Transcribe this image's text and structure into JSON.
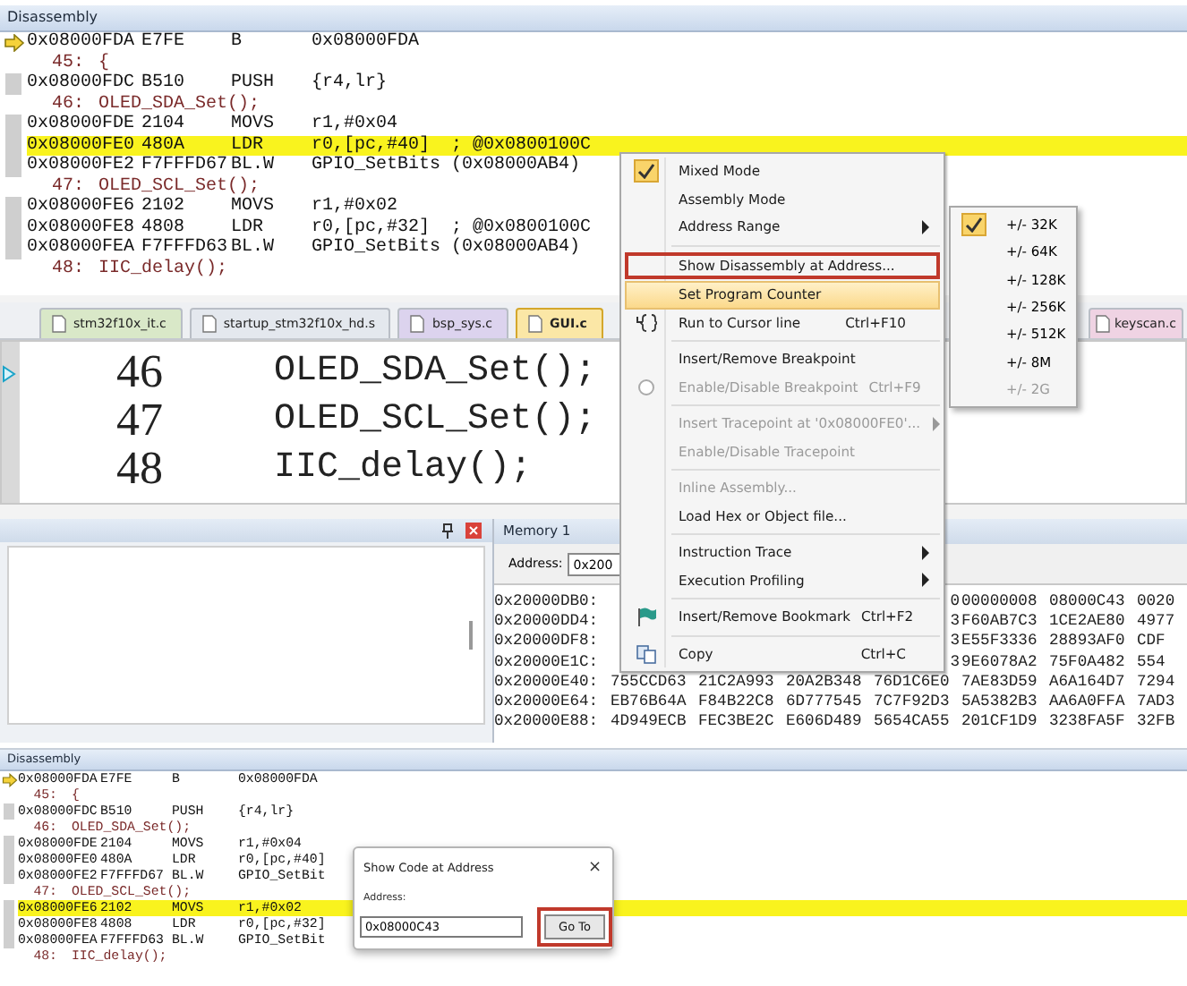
{
  "top_disassembly": {
    "title": "Disassembly",
    "rows": [
      {
        "kind": "asm",
        "address": "0x08000FDA",
        "code": "E7FE",
        "mnemonic": "B",
        "operands": "0x08000FDA",
        "current": true,
        "highlighted": false
      },
      {
        "kind": "src",
        "line": "45:",
        "text": "{"
      },
      {
        "kind": "asm",
        "address": "0x08000FDC",
        "code": "B510",
        "mnemonic": "PUSH",
        "operands": "{r4,lr}",
        "current": false,
        "highlighted": false
      },
      {
        "kind": "src",
        "line": "46:",
        "text": "OLED_SDA_Set();"
      },
      {
        "kind": "asm",
        "address": "0x08000FDE",
        "code": "2104",
        "mnemonic": "MOVS",
        "operands": "r1,#0x04",
        "current": false,
        "highlighted": false
      },
      {
        "kind": "asm",
        "address": "0x08000FE0",
        "code": "480A",
        "mnemonic": "LDR",
        "operands": "r0,[pc,#40]  ; @0x0800100C",
        "current": false,
        "highlighted": true
      },
      {
        "kind": "asm",
        "address": "0x08000FE2",
        "code": "F7FFFD67",
        "mnemonic": "BL.W",
        "operands": "GPIO_SetBits (0x08000AB4)",
        "current": false,
        "highlighted": false
      },
      {
        "kind": "src",
        "line": "47:",
        "text": "OLED_SCL_Set();"
      },
      {
        "kind": "asm",
        "address": "0x08000FE6",
        "code": "2102",
        "mnemonic": "MOVS",
        "operands": "r1,#0x02",
        "current": false,
        "highlighted": false
      },
      {
        "kind": "asm",
        "address": "0x08000FE8",
        "code": "4808",
        "mnemonic": "LDR",
        "operands": "r0,[pc,#32]  ; @0x0800100C",
        "current": false,
        "highlighted": false
      },
      {
        "kind": "asm",
        "address": "0x08000FEA",
        "code": "F7FFFD63",
        "mnemonic": "BL.W",
        "operands": "GPIO_SetBits (0x08000AB4)",
        "current": false,
        "highlighted": false
      },
      {
        "kind": "src",
        "line": "48:",
        "text": "IIC_delay();"
      }
    ]
  },
  "editor": {
    "tabs": [
      {
        "label": "stm32f10x_it.c",
        "color": "#d9e8c8",
        "selected": false
      },
      {
        "label": "startup_stm32f10x_hd.s",
        "color": "#e4e8ee",
        "selected": false
      },
      {
        "label": "bsp_sys.c",
        "color": "#dcd3ee",
        "selected": false
      },
      {
        "label": "GUI.c",
        "color": "#fbe7a6",
        "selected": true
      },
      {
        "label": "keyscan.c",
        "color": "#efd3e3",
        "selected": false
      }
    ],
    "lines": [
      {
        "number": "46",
        "code": "OLED_SDA_Set();",
        "current": true
      },
      {
        "number": "47",
        "code": "OLED_SCL_Set();",
        "current": false
      },
      {
        "number": "48",
        "code": "IIC_delay();",
        "current": false
      }
    ]
  },
  "memory": {
    "title": "Memory 1",
    "address_label": "Address:",
    "address_value": "0x200",
    "rows": [
      {
        "address": "0x20000DB0:",
        "values": [
          "0",
          "00000008",
          "08000C43",
          "0020"
        ]
      },
      {
        "address": "0x20000DD4:",
        "values": [
          "3",
          "F60AB7C3",
          "1CE2AE80",
          "4977"
        ]
      },
      {
        "address": "0x20000DF8:",
        "values": [
          "3",
          "E55F3336",
          "28893AF0",
          "CDF"
        ]
      },
      {
        "address": "0x20000E1C:",
        "values": [
          "3",
          "9E6078A2",
          "75F0A482",
          "554"
        ]
      },
      {
        "address": "0x20000E40:",
        "values": [
          "755CCD63",
          "21C2A993",
          "20A2B348",
          "76D1C6E0",
          "7AE83D59",
          "A6A164D7",
          "7294"
        ]
      },
      {
        "address": "0x20000E64:",
        "values": [
          "EB76B64A",
          "F84B22C8",
          "6D777545",
          "7C7F92D3",
          "5A5382B3",
          "AA6A0FFA",
          "7AD3"
        ]
      },
      {
        "address": "0x20000E88:",
        "values": [
          "4D949ECB",
          "FEC3BE2C",
          "E606D489",
          "5654CA55",
          "201CF1D9",
          "3238FA5F",
          "32FB"
        ]
      }
    ]
  },
  "context_menu": {
    "items": [
      {
        "kind": "item",
        "label": "Mixed Mode",
        "checked": true,
        "disabled": false,
        "selected": false,
        "submenu": false,
        "outlined": false
      },
      {
        "kind": "item",
        "label": "Assembly Mode",
        "checked": false,
        "disabled": false,
        "selected": false,
        "submenu": false,
        "outlined": false
      },
      {
        "kind": "item",
        "label": "Address Range",
        "checked": false,
        "disabled": false,
        "selected": false,
        "submenu": true,
        "outlined": false
      },
      {
        "kind": "separator"
      },
      {
        "kind": "item",
        "label": "Show Disassembly at Address...",
        "checked": false,
        "disabled": false,
        "selected": false,
        "submenu": false,
        "outlined": true
      },
      {
        "kind": "item",
        "label": "Set Program Counter",
        "checked": false,
        "disabled": false,
        "selected": true,
        "submenu": false,
        "outlined": false
      },
      {
        "kind": "run",
        "label": "Run to Cursor line",
        "shortcut": "Ctrl+F10",
        "checked": false,
        "disabled": false,
        "selected": false,
        "submenu": false,
        "outlined": false
      },
      {
        "kind": "separator"
      },
      {
        "kind": "item",
        "label": "Insert/Remove Breakpoint",
        "checked": false,
        "disabled": false,
        "selected": false,
        "submenu": false,
        "outlined": false
      },
      {
        "kind": "breakpoint",
        "label": "Enable/Disable Breakpoint",
        "shortcut": "Ctrl+F9",
        "checked": false,
        "disabled": true,
        "selected": false,
        "submenu": false,
        "outlined": false
      },
      {
        "kind": "separator"
      },
      {
        "kind": "item",
        "label": "Insert Tracepoint at '0x08000FE0'...",
        "checked": false,
        "disabled": true,
        "selected": false,
        "submenu": true,
        "outlined": false
      },
      {
        "kind": "item",
        "label": "Enable/Disable Tracepoint",
        "checked": false,
        "disabled": true,
        "selected": false,
        "submenu": false,
        "outlined": false
      },
      {
        "kind": "separator"
      },
      {
        "kind": "item",
        "label": "Inline Assembly...",
        "checked": false,
        "disabled": true,
        "selected": false,
        "submenu": false,
        "outlined": false
      },
      {
        "kind": "item",
        "label": "Load Hex or Object file...",
        "checked": false,
        "disabled": false,
        "selected": false,
        "submenu": false,
        "outlined": false
      },
      {
        "kind": "separator"
      },
      {
        "kind": "item",
        "label": "Instruction Trace",
        "checked": false,
        "disabled": false,
        "selected": false,
        "submenu": true,
        "outlined": false
      },
      {
        "kind": "item",
        "label": "Execution Profiling",
        "checked": false,
        "disabled": false,
        "selected": false,
        "submenu": true,
        "outlined": false
      },
      {
        "kind": "separator"
      },
      {
        "kind": "bookmark",
        "label": "Insert/Remove Bookmark",
        "shortcut": "Ctrl+F2",
        "checked": false,
        "disabled": false,
        "selected": false,
        "submenu": false,
        "outlined": false
      },
      {
        "kind": "separator"
      },
      {
        "kind": "copy",
        "label": "Copy",
        "shortcut": "Ctrl+C",
        "checked": false,
        "disabled": false,
        "selected": false,
        "submenu": false,
        "outlined": false
      }
    ]
  },
  "address_range_submenu": {
    "items": [
      {
        "label": "+/- 32K",
        "checked": true,
        "disabled": false
      },
      {
        "label": "+/- 64K",
        "checked": false,
        "disabled": false
      },
      {
        "label": "+/- 128K",
        "checked": false,
        "disabled": false
      },
      {
        "label": "+/- 256K",
        "checked": false,
        "disabled": false
      },
      {
        "label": "+/- 512K",
        "checked": false,
        "disabled": false
      },
      {
        "label": "+/- 8M",
        "checked": false,
        "disabled": false
      },
      {
        "label": "+/- 2G",
        "checked": false,
        "disabled": true
      }
    ]
  },
  "bottom_disassembly": {
    "title": "Disassembly",
    "rows": [
      {
        "kind": "asm",
        "address": "0x08000FDA",
        "code": "E7FE",
        "mnemonic": "B",
        "operands": "0x08000FDA",
        "current": true,
        "highlighted": false
      },
      {
        "kind": "src",
        "line": "45:",
        "text": "{"
      },
      {
        "kind": "asm",
        "address": "0x08000FDC",
        "code": "B510",
        "mnemonic": "PUSH",
        "operands": "{r4,lr}",
        "current": false,
        "highlighted": false
      },
      {
        "kind": "src",
        "line": "46:",
        "text": "OLED_SDA_Set();"
      },
      {
        "kind": "asm",
        "address": "0x08000FDE",
        "code": "2104",
        "mnemonic": "MOVS",
        "operands": "r1,#0x04",
        "current": false,
        "highlighted": false
      },
      {
        "kind": "asm",
        "address": "0x08000FE0",
        "code": "480A",
        "mnemonic": "LDR",
        "operands": "r0,[pc,#40]",
        "current": false,
        "highlighted": false
      },
      {
        "kind": "asm",
        "address": "0x08000FE2",
        "code": "F7FFFD67",
        "mnemonic": "BL.W",
        "operands": "GPIO_SetBit",
        "current": false,
        "highlighted": false
      },
      {
        "kind": "src",
        "line": "47:",
        "text": "OLED_SCL_Set();"
      },
      {
        "kind": "asm",
        "address": "0x08000FE6",
        "code": "2102",
        "mnemonic": "MOVS",
        "operands": "r1,#0x02",
        "current": false,
        "highlighted": true
      },
      {
        "kind": "asm",
        "address": "0x08000FE8",
        "code": "4808",
        "mnemonic": "LDR",
        "operands": "r0,[pc,#32]",
        "current": false,
        "highlighted": false
      },
      {
        "kind": "asm",
        "address": "0x08000FEA",
        "code": "F7FFFD63",
        "mnemonic": "BL.W",
        "operands": "GPIO_SetBit",
        "current": false,
        "highlighted": false
      },
      {
        "kind": "src",
        "line": "48:",
        "text": "IIC_delay();"
      }
    ]
  },
  "dialog": {
    "title": "Show Code at Address",
    "close": "×",
    "address_label": "Address:",
    "address_value": "0x08000C43",
    "button": "Go To",
    "button_outlined": true
  }
}
